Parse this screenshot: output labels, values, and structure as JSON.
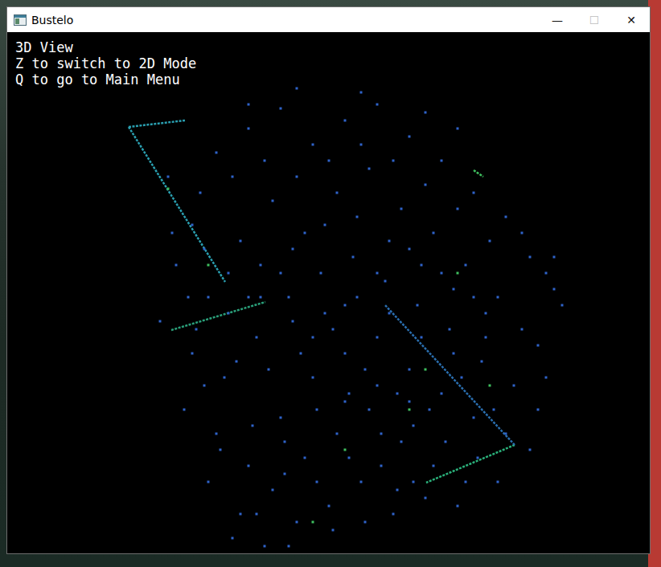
{
  "window": {
    "title": "Bustelo",
    "controls": [
      {
        "glyph": "—",
        "disabled": false
      },
      {
        "glyph": "☐",
        "disabled": true
      },
      {
        "glyph": "✕",
        "disabled": false
      }
    ]
  },
  "overlay": [
    "3D View",
    "Z to switch to 2D Mode",
    "Q to go to Main Menu"
  ],
  "scene": {
    "series": [
      {
        "name": "points",
        "color": "#2f63c9",
        "points": [
          [
            200,
            180
          ],
          [
            230,
            240
          ],
          [
            260,
            150
          ],
          [
            300,
            120
          ],
          [
            340,
            95
          ],
          [
            380,
            140
          ],
          [
            420,
            110
          ],
          [
            460,
            90
          ],
          [
            500,
            130
          ],
          [
            540,
            160
          ],
          [
            580,
            200
          ],
          [
            620,
            230
          ],
          [
            650,
            280
          ],
          [
            670,
            300
          ],
          [
            210,
            290
          ],
          [
            250,
            330
          ],
          [
            290,
            260
          ],
          [
            330,
            210
          ],
          [
            370,
            250
          ],
          [
            410,
            200
          ],
          [
            450,
            170
          ],
          [
            490,
            220
          ],
          [
            530,
            250
          ],
          [
            570,
            290
          ],
          [
            610,
            330
          ],
          [
            640,
            370
          ],
          [
            680,
            320
          ],
          [
            190,
            360
          ],
          [
            230,
            400
          ],
          [
            270,
            430
          ],
          [
            310,
            380
          ],
          [
            350,
            330
          ],
          [
            390,
            300
          ],
          [
            430,
            280
          ],
          [
            470,
            310
          ],
          [
            510,
            340
          ],
          [
            550,
            370
          ],
          [
            590,
            410
          ],
          [
            630,
            440
          ],
          [
            660,
            470
          ],
          [
            220,
            470
          ],
          [
            260,
            500
          ],
          [
            300,
            540
          ],
          [
            340,
            480
          ],
          [
            380,
            430
          ],
          [
            420,
            400
          ],
          [
            460,
            380
          ],
          [
            500,
            420
          ],
          [
            540,
            450
          ],
          [
            580,
            480
          ],
          [
            620,
            500
          ],
          [
            250,
            560
          ],
          [
            290,
            600
          ],
          [
            330,
            570
          ],
          [
            370,
            530
          ],
          [
            410,
            500
          ],
          [
            450,
            470
          ],
          [
            490,
            510
          ],
          [
            530,
            540
          ],
          [
            570,
            560
          ],
          [
            280,
            630
          ],
          [
            320,
            640
          ],
          [
            360,
            610
          ],
          [
            400,
            590
          ],
          [
            440,
            560
          ],
          [
            480,
            600
          ],
          [
            520,
            580
          ],
          [
            300,
            90
          ],
          [
            360,
            70
          ],
          [
            440,
            75
          ],
          [
            520,
            100
          ],
          [
            560,
            120
          ],
          [
            240,
            200
          ],
          [
            280,
            180
          ],
          [
            320,
            160
          ],
          [
            360,
            180
          ],
          [
            400,
            160
          ],
          [
            440,
            140
          ],
          [
            480,
            160
          ],
          [
            520,
            190
          ],
          [
            560,
            220
          ],
          [
            600,
            260
          ],
          [
            640,
            250
          ],
          [
            275,
            300
          ],
          [
            315,
            290
          ],
          [
            355,
            270
          ],
          [
            395,
            240
          ],
          [
            435,
            230
          ],
          [
            475,
            260
          ],
          [
            515,
            290
          ],
          [
            555,
            320
          ],
          [
            595,
            350
          ],
          [
            235,
            370
          ],
          [
            275,
            350
          ],
          [
            315,
            330
          ],
          [
            355,
            360
          ],
          [
            395,
            350
          ],
          [
            435,
            330
          ],
          [
            475,
            350
          ],
          [
            515,
            380
          ],
          [
            555,
            400
          ],
          [
            595,
            380
          ],
          [
            245,
            440
          ],
          [
            285,
            410
          ],
          [
            325,
            420
          ],
          [
            365,
            400
          ],
          [
            405,
            370
          ],
          [
            445,
            420
          ],
          [
            485,
            450
          ],
          [
            525,
            470
          ],
          [
            565,
            430
          ],
          [
            605,
            470
          ],
          [
            265,
            520
          ],
          [
            305,
            490
          ],
          [
            345,
            510
          ],
          [
            385,
            470
          ],
          [
            425,
            450
          ],
          [
            465,
            500
          ],
          [
            505,
            490
          ],
          [
            545,
            510
          ],
          [
            585,
            530
          ],
          [
            345,
            550
          ],
          [
            385,
            560
          ],
          [
            425,
            530
          ],
          [
            465,
            540
          ],
          [
            505,
            560
          ],
          [
            405,
            620
          ],
          [
            445,
            610
          ],
          [
            485,
            570
          ],
          [
            205,
            250
          ],
          [
            225,
            330
          ],
          [
            245,
            270
          ],
          [
            680,
            280
          ],
          [
            690,
            340
          ],
          [
            660,
            390
          ],
          [
            670,
            430
          ],
          [
            650,
            520
          ],
          [
            610,
            560
          ],
          [
            560,
            590
          ],
          [
            310,
            600
          ],
          [
            350,
            640
          ],
          [
            420,
            460
          ],
          [
            460,
            440
          ],
          [
            500,
            460
          ],
          [
            380,
            380
          ],
          [
            420,
            340
          ],
          [
            460,
            300
          ],
          [
            500,
            270
          ],
          [
            540,
            300
          ],
          [
            580,
            330
          ],
          [
            340,
            300
          ],
          [
            300,
            330
          ]
        ]
      },
      {
        "name": "highlights",
        "color": "#3fbf5f",
        "points": [
          [
            200,
            195
          ],
          [
            250,
            290
          ],
          [
            560,
            300
          ],
          [
            500,
            470
          ],
          [
            420,
            520
          ],
          [
            380,
            610
          ],
          [
            520,
            420
          ],
          [
            600,
            440
          ]
        ]
      }
    ],
    "edges": [
      {
        "from": [
          151,
          118
        ],
        "to": [
          271,
          311
        ],
        "color": "#2a9fb0"
      },
      {
        "from": [
          151,
          118
        ],
        "to": [
          221,
          110
        ],
        "color": "#2a9fb0"
      },
      {
        "from": [
          204,
          371
        ],
        "to": [
          321,
          336
        ],
        "color": "#2aa07a"
      },
      {
        "from": [
          631,
          514
        ],
        "to": [
          521,
          561
        ],
        "color": "#2ab07a"
      },
      {
        "from": [
          631,
          514
        ],
        "to": [
          470,
          340
        ],
        "color": "#2a6fb0"
      },
      {
        "from": [
          580,
          172
        ],
        "to": [
          592,
          180
        ],
        "color": "#3fbf5f"
      }
    ]
  }
}
